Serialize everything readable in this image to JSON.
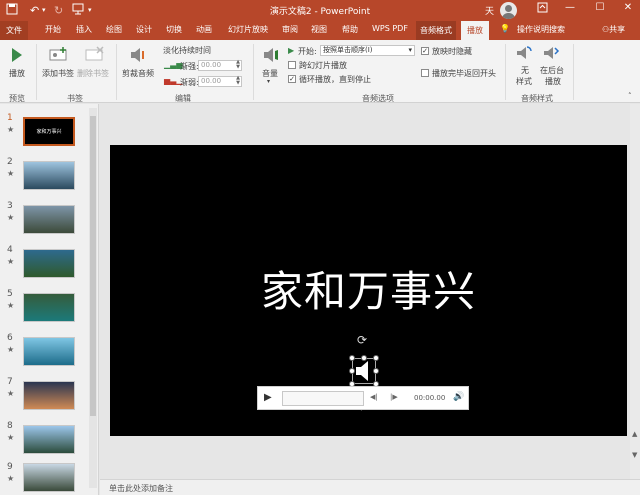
{
  "titlebar": {
    "title": "演示文稿2 - PowerPoint",
    "user_name": "天",
    "accent_color": "#b7472a"
  },
  "tabs": {
    "file": "文件",
    "items": [
      "开始",
      "插入",
      "绘图",
      "设计",
      "切换",
      "动画",
      "幻灯片放映",
      "审阅",
      "视图",
      "帮助",
      "WPS PDF"
    ],
    "context_group": "音频格式",
    "active": "播放",
    "tell_me": "操作说明搜索",
    "share": "共享"
  },
  "ribbon": {
    "preview": {
      "play_label": "播放",
      "group_label": "预览"
    },
    "bookmarks": {
      "add_label": "添加书签",
      "remove_label": "删除书签",
      "group_label": "书签"
    },
    "editing": {
      "trim_label": "剪裁音频",
      "fade_title": "淡化持续时间",
      "fade_in_label": "渐强:",
      "fade_in_value": "00.00",
      "fade_out_label": "渐弱:",
      "fade_out_value": "00.00",
      "group_label": "编辑"
    },
    "audio_options": {
      "volume_label": "音量",
      "start_label": "开始:",
      "start_value": "按照单击顺序(I)",
      "cross_slides_label": "跨幻灯片播放",
      "cross_slides_checked": false,
      "loop_label": "循环播放，直到停止",
      "loop_checked": true,
      "hide_label": "放映时隐藏",
      "hide_checked": true,
      "rewind_label": "播放完毕返回开头",
      "rewind_checked": false,
      "group_label": "音频选项"
    },
    "audio_styles": {
      "no_style_line1": "无",
      "no_style_line2": "样式",
      "bg_play_line1": "在后台",
      "bg_play_line2": "播放",
      "group_label": "音频样式"
    }
  },
  "thumbnails": [
    {
      "num": "1",
      "star": "★",
      "title": "家和万事兴",
      "colors": [
        "#000000",
        "#000000"
      ]
    },
    {
      "num": "2",
      "star": "★",
      "colors": [
        "#9ec4df",
        "#2c4a5e"
      ]
    },
    {
      "num": "3",
      "star": "★",
      "colors": [
        "#7e95a8",
        "#3c4a3a"
      ]
    },
    {
      "num": "4",
      "star": "★",
      "colors": [
        "#2e6a8e",
        "#2f5a2c"
      ]
    },
    {
      "num": "5",
      "star": "★",
      "colors": [
        "#355c3c",
        "#1c7a7a"
      ]
    },
    {
      "num": "6",
      "star": "★",
      "colors": [
        "#7fc6e4",
        "#1d6c8a"
      ]
    },
    {
      "num": "7",
      "star": "★",
      "colors": [
        "#2a3550",
        "#d08a54"
      ]
    },
    {
      "num": "8",
      "star": "★",
      "colors": [
        "#9cc6ea",
        "#2c4c3c"
      ]
    },
    {
      "num": "9",
      "star": "★",
      "colors": [
        "#c9d8e4",
        "#3a4a3a"
      ]
    }
  ],
  "slide": {
    "title": "家和万事兴"
  },
  "player": {
    "time": "00:00.00"
  },
  "notes": {
    "placeholder": "单击此处添加备注"
  }
}
